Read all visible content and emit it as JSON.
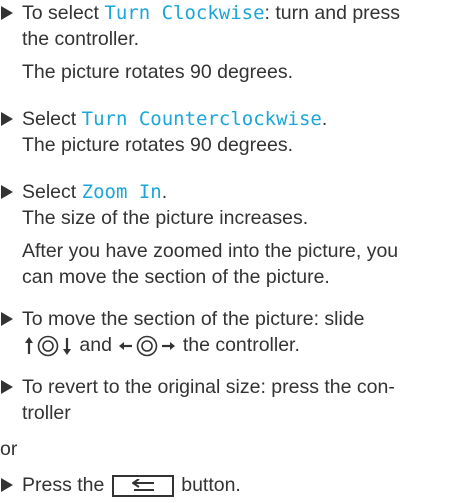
{
  "items": [
    {
      "bullet": true,
      "line1_prefix": "To select ",
      "line1_ui": "Turn Clockwise",
      "line1_suffix": ": turn and press",
      "line2": "the controller.",
      "line3": "The picture rotates 90 degrees."
    },
    {
      "bullet": true,
      "line1_prefix": "Select ",
      "line1_ui": "Turn Counterclockwise",
      "line1_suffix": ".",
      "line2": "The picture rotates 90 degrees."
    },
    {
      "bullet": true,
      "line1_prefix": "Select ",
      "line1_ui": "Zoom In",
      "line1_suffix": ".",
      "line2": "The size of the picture increases.",
      "line3": "After you have zoomed into the picture, you",
      "line4": "can move the section of the picture."
    },
    {
      "bullet": true,
      "line1": "To move the section of the picture: slide",
      "line2_and": "and",
      "line2_suffix": "the controller."
    },
    {
      "bullet": true,
      "line1": "To revert to the original size: press the con-",
      "line2": "troller"
    },
    {
      "bullet": false,
      "line1": "or"
    },
    {
      "bullet": true,
      "line1_prefix": "Press the",
      "line1_suffix": "button.",
      "button_icon": "back-icon"
    }
  ],
  "colors": {
    "text": "#333333",
    "ui_highlight": "#1aa6d8"
  },
  "icons": {
    "controller_vertical": "controller-slide-up-down-icon",
    "controller_horizontal": "controller-slide-left-right-icon",
    "back_button": "back-button-icon"
  }
}
